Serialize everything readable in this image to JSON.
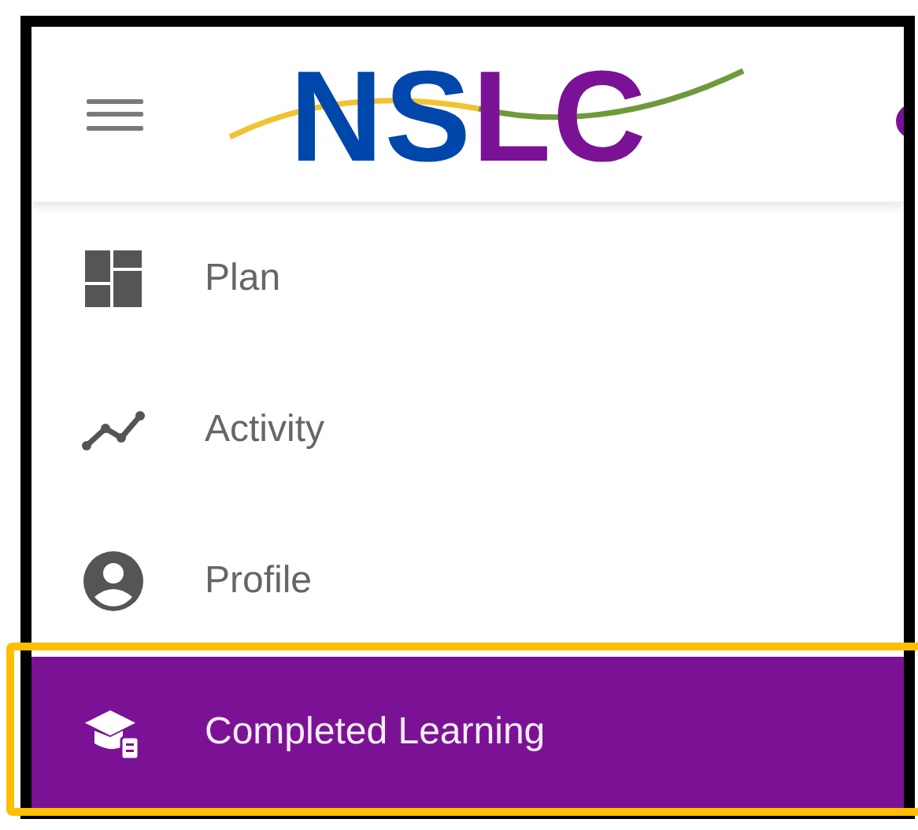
{
  "header": {
    "logo": [
      {
        "text": "NS",
        "color": "#0047ab"
      },
      {
        "text": "LC",
        "color": "#7b1295"
      }
    ]
  },
  "nav": [
    {
      "label": "Plan",
      "kind": "plan",
      "selected": false
    },
    {
      "label": "Activity",
      "kind": "activity",
      "selected": false
    },
    {
      "label": "Profile",
      "kind": "profile",
      "selected": false
    },
    {
      "label": "Completed Learning",
      "kind": "completed",
      "selected": true
    }
  ]
}
